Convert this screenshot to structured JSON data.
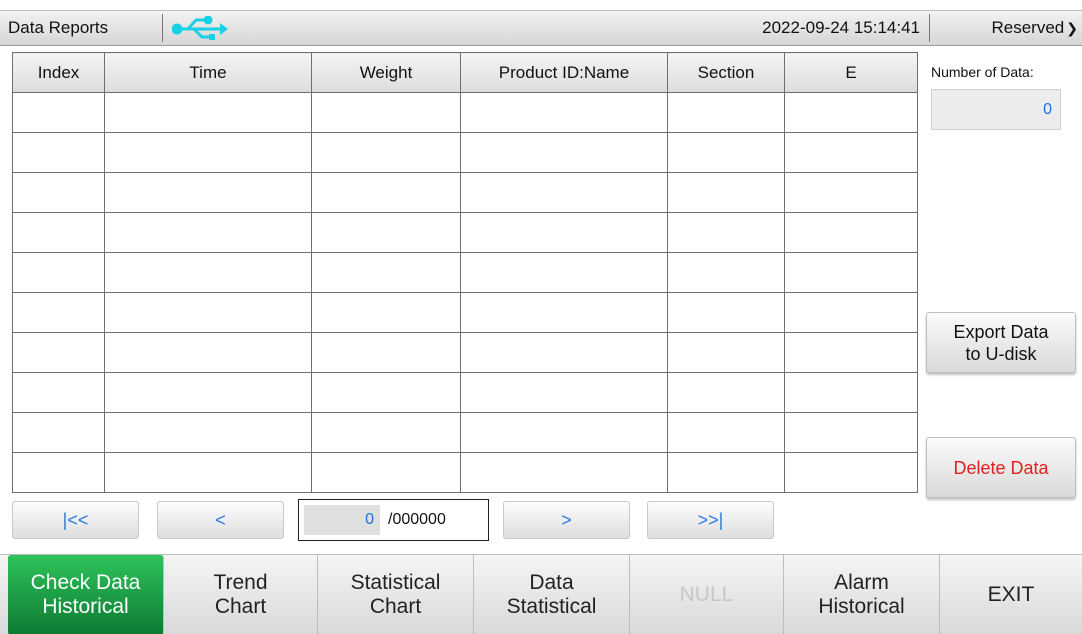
{
  "header": {
    "title": "Data Reports",
    "usb_icon": "usb-icon",
    "datetime": "2022-09-24 15:14:41",
    "reserved_label": "Reserved",
    "reserved_arrow": "❯"
  },
  "table": {
    "columns": [
      "Index",
      "Time",
      "Weight",
      "Product ID:Name",
      "Section",
      "E"
    ],
    "rows": [
      [
        "",
        "",
        "",
        "",
        "",
        ""
      ],
      [
        "",
        "",
        "",
        "",
        "",
        ""
      ],
      [
        "",
        "",
        "",
        "",
        "",
        ""
      ],
      [
        "",
        "",
        "",
        "",
        "",
        ""
      ],
      [
        "",
        "",
        "",
        "",
        "",
        ""
      ],
      [
        "",
        "",
        "",
        "",
        "",
        ""
      ],
      [
        "",
        "",
        "",
        "",
        "",
        ""
      ],
      [
        "",
        "",
        "",
        "",
        "",
        ""
      ],
      [
        "",
        "",
        "",
        "",
        "",
        ""
      ],
      [
        "",
        "",
        "",
        "",
        "",
        ""
      ]
    ]
  },
  "side": {
    "number_label": "Number of Data:",
    "number_value": "0",
    "export_line1": "Export Data",
    "export_line2": "to U-disk",
    "delete_label": "Delete Data"
  },
  "paging": {
    "first": "|<<",
    "prev": "<",
    "current": "0",
    "total": "/000000",
    "next": ">",
    "last": ">>|"
  },
  "nav": {
    "items": [
      {
        "line1": "Check Data",
        "line2": "Historical"
      },
      {
        "line1": "Trend",
        "line2": "Chart"
      },
      {
        "line1": "Statistical",
        "line2": "Chart"
      },
      {
        "line1": "Data",
        "line2": "Statistical"
      },
      {
        "line1": "NULL",
        "line2": ""
      },
      {
        "line1": "Alarm",
        "line2": "Historical"
      },
      {
        "line1": "EXIT",
        "line2": ""
      }
    ]
  },
  "colors": {
    "accent_blue": "#2a7be0",
    "delete_red": "#e11f1f",
    "active_green": "#0d7a33",
    "usb_cyan": "#19d0e6"
  }
}
